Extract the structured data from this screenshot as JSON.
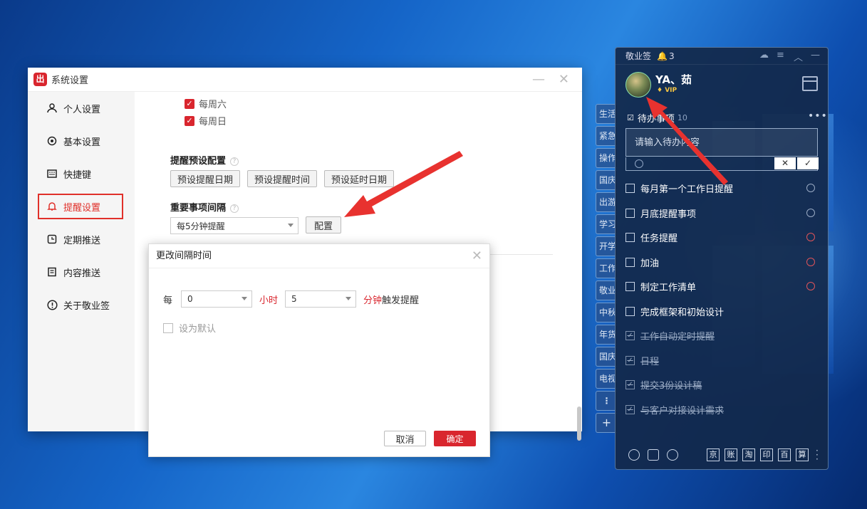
{
  "settings_window": {
    "title": "系统设置",
    "logo_glyph": "出",
    "minimize_glyph": "—",
    "close_glyph": "✕",
    "nav": [
      {
        "label": "个人设置",
        "icon": "user-icon"
      },
      {
        "label": "基本设置",
        "icon": "gear-icon"
      },
      {
        "label": "快捷键",
        "icon": "keyboard-icon"
      },
      {
        "label": "提醒设置",
        "icon": "bell-icon",
        "active": true
      },
      {
        "label": "定期推送",
        "icon": "schedule-icon"
      },
      {
        "label": "内容推送",
        "icon": "document-icon"
      },
      {
        "label": "关于敬业签",
        "icon": "info-icon"
      }
    ],
    "content": {
      "saturday": "每周六",
      "sunday": "每周日",
      "preset_title": "提醒预设配置",
      "preset_buttons": [
        "预设提醒日期",
        "预设提醒时间",
        "预设延时日期"
      ],
      "interval_title": "重要事项间隔",
      "interval_value": "每5分钟提醒",
      "config_button": "配置"
    }
  },
  "dialog": {
    "title": "更改间隔时间",
    "close_glyph": "✕",
    "every": "每",
    "hours_value": "0",
    "hours_unit": "小时",
    "minutes_value": "5",
    "minutes_unit": "分钟",
    "trigger": "触发提醒",
    "set_default": "设为默认",
    "cancel": "取消",
    "confirm": "确定"
  },
  "side_tabs": [
    "生活",
    "紧急",
    "操作",
    "国庆",
    "出游",
    "学习",
    "开学",
    "工作",
    "敬业",
    "中秋",
    "年货",
    "国庆",
    "电视"
  ],
  "side_tab_more": "⋮",
  "side_tab_add": "+",
  "panel": {
    "app_name": "敬业签",
    "notif_count": "3",
    "username": "YA、茹",
    "vip": "VIP",
    "todo_title": "待办事项",
    "todo_count": "10",
    "more_glyph": "•••",
    "input_placeholder": "请输入待办内容",
    "input_cancel": "✕",
    "input_ok": "✓",
    "tasks": [
      {
        "text": "每月第一个工作日提醒",
        "done": false,
        "clock": "normal"
      },
      {
        "text": "月底提醒事项",
        "done": false,
        "clock": "normal"
      },
      {
        "text": "任务提醒",
        "done": false,
        "clock": "red"
      },
      {
        "text": "加油",
        "done": false,
        "clock": "red"
      },
      {
        "text": "制定工作清单",
        "done": false,
        "clock": "red"
      },
      {
        "text": "完成框架和初始设计",
        "done": false,
        "clock": "none"
      },
      {
        "text": "工作自动定时提醒",
        "done": true,
        "clock": "none"
      },
      {
        "text": "日程",
        "done": true,
        "clock": "none"
      },
      {
        "text": "提交3份设计稿",
        "done": true,
        "clock": "none"
      },
      {
        "text": "与客户对接设计需求",
        "done": true,
        "clock": "none"
      }
    ],
    "checkmark": "✓",
    "quick_links": [
      "京",
      "账",
      "淘",
      "印",
      "百",
      "算"
    ]
  },
  "colors": {
    "accent": "#d9262e",
    "panel_bg": "#12284a"
  }
}
